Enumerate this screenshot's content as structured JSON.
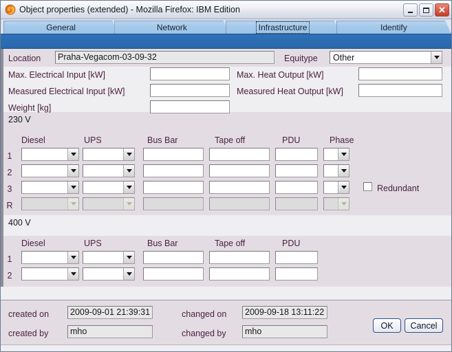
{
  "window": {
    "title": "Object properties (extended) - Mozilla Firefox: IBM Edition",
    "app_icon": "firefox-icon",
    "controls": {
      "minimize": "minimize-icon",
      "maximize": "maximize-icon",
      "close": "✕"
    }
  },
  "tabs": [
    {
      "label": "General",
      "active": false
    },
    {
      "label": "Network",
      "active": false
    },
    {
      "label": "Infrastructure",
      "active": true
    },
    {
      "label": "Identify",
      "active": false
    }
  ],
  "general": {
    "location_label": "Location",
    "location_value": "Praha-Vegacom-03-09-32",
    "equitype_label": "Equitype",
    "equitype_value": "Other",
    "max_electrical_input_label": "Max. Electrical Input [kW]",
    "max_electrical_input_value": "",
    "max_heat_output_label": "Max. Heat Output [kW]",
    "max_heat_output_value": "",
    "measured_electrical_input_label": "Measured Electrical Input [kW]",
    "measured_electrical_input_value": "",
    "measured_heat_output_label": "Measured Heat Output [kW]",
    "measured_heat_output_value": "",
    "weight_label": "Weight [kg]",
    "weight_value": ""
  },
  "section_230": {
    "title": "230 V",
    "columns": [
      "Diesel",
      "UPS",
      "Bus Bar",
      "Tape off",
      "PDU",
      "Phase"
    ],
    "rows": [
      {
        "index": "1",
        "disabled": false,
        "diesel": "",
        "ups": "",
        "bus_bar": "",
        "tape_off": "",
        "pdu": "",
        "phase": ""
      },
      {
        "index": "2",
        "disabled": false,
        "diesel": "",
        "ups": "",
        "bus_bar": "",
        "tape_off": "",
        "pdu": "",
        "phase": ""
      },
      {
        "index": "3",
        "disabled": false,
        "diesel": "",
        "ups": "",
        "bus_bar": "",
        "tape_off": "",
        "pdu": "",
        "phase": ""
      },
      {
        "index": "R",
        "disabled": true,
        "diesel": "",
        "ups": "",
        "bus_bar": "",
        "tape_off": "",
        "pdu": "",
        "phase": ""
      }
    ],
    "redundant_label": "Redundant",
    "redundant_checked": false
  },
  "section_400": {
    "title": "400 V",
    "columns": [
      "Diesel",
      "UPS",
      "Bus Bar",
      "Tape off",
      "PDU"
    ],
    "rows": [
      {
        "index": "1",
        "disabled": false,
        "diesel": "",
        "ups": "",
        "bus_bar": "",
        "tape_off": "",
        "pdu": ""
      },
      {
        "index": "2",
        "disabled": false,
        "diesel": "",
        "ups": "",
        "bus_bar": "",
        "tape_off": "",
        "pdu": ""
      }
    ]
  },
  "footer": {
    "created_on_label": "created on",
    "created_on_value": "2009-09-01 21:39:31",
    "changed_on_label": "changed on",
    "changed_on_value": "2009-09-18 13:11:22",
    "created_by_label": "created by",
    "created_by_value": "mho",
    "changed_by_label": "changed by",
    "changed_by_value": "mho",
    "ok_label": "OK",
    "cancel_label": "Cancel"
  },
  "colors": {
    "title_bar": "#eef0f5",
    "tab_active": "#a4c9ea",
    "blue_band": "#2b6cb0",
    "label_text": "#4a2040",
    "band_alt": "#e3dde3"
  }
}
